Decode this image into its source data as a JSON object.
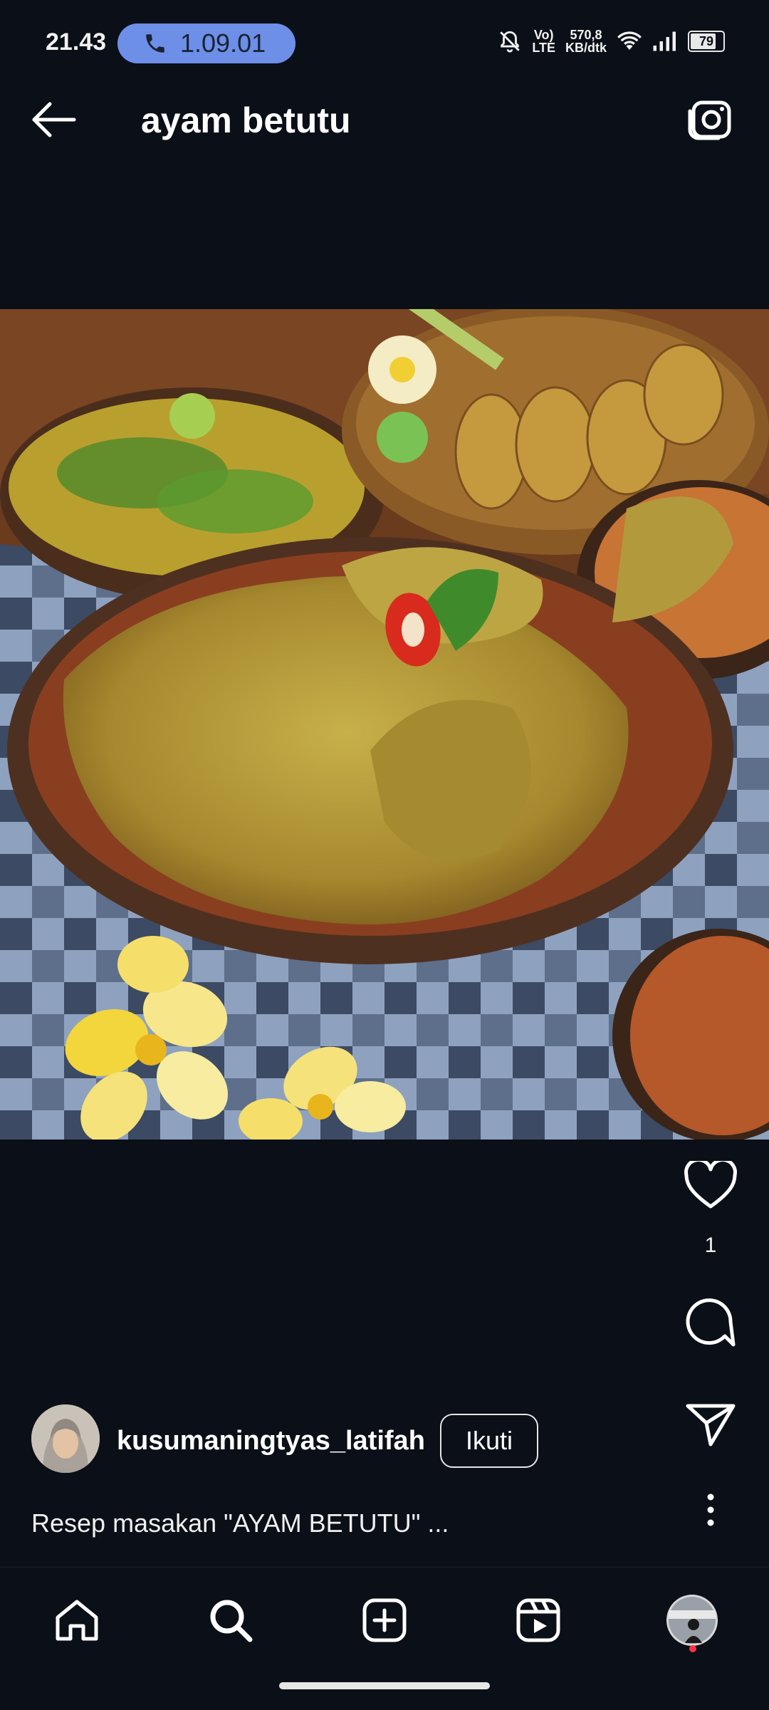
{
  "status_bar": {
    "time": "21.43",
    "call_timer": "1.09.01",
    "net_line1": "Vo)",
    "net_line2": "LTE",
    "speed_line1": "570,8",
    "speed_line2": "KB/dtk",
    "battery": "79"
  },
  "header": {
    "title": "ayam betutu"
  },
  "post": {
    "like_count": "1",
    "username": "kusumaningtyas_latifah",
    "follow_label": "Ikuti",
    "caption": "Resep masakan \"AYAM BETUTU\" ..."
  },
  "icons": {
    "back": "arrow-left-icon",
    "camera": "camera-icon",
    "like": "heart-icon",
    "comment": "comment-icon",
    "share": "send-icon",
    "more": "more-vertical-icon",
    "home": "home-icon",
    "search": "search-icon",
    "create": "plus-square-icon",
    "reels": "reels-icon",
    "profile": "profile-avatar-icon"
  },
  "colors": {
    "background": "#0b0f17",
    "call_pill": "#6d8fe8",
    "notification_dot": "#ff3040"
  }
}
